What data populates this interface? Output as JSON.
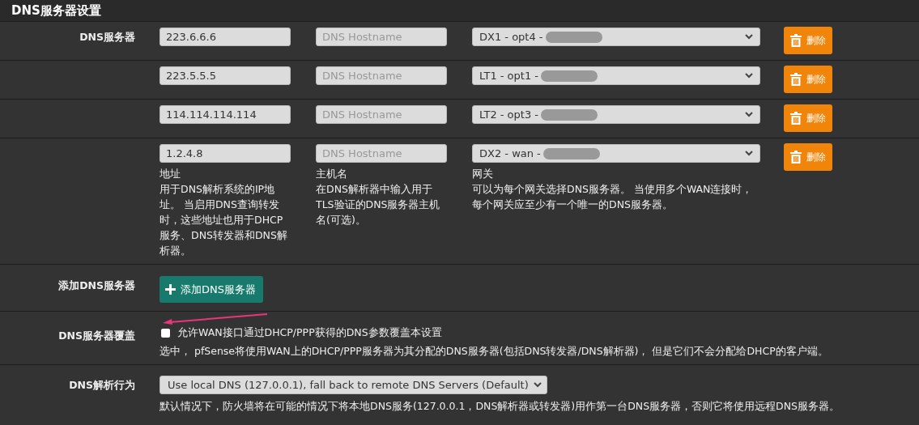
{
  "section_title": "DNS服务器设置",
  "dns_servers": {
    "label": "DNS服务器",
    "rows": [
      {
        "address": "223.6.6.6",
        "placeholder": "DNS Hostname",
        "gateway": "DX1 - opt4 -",
        "delete_label": "删除"
      },
      {
        "address": "223.5.5.5",
        "placeholder": "DNS Hostname",
        "gateway": "LT1 - opt1 -",
        "delete_label": "删除"
      },
      {
        "address": "114.114.114.114",
        "placeholder": "DNS Hostname",
        "gateway": "LT2 - opt3 -",
        "delete_label": "删除"
      },
      {
        "address": "1.2.4.8",
        "placeholder": "DNS Hostname",
        "gateway": "DX2 - wan -",
        "delete_label": "删除"
      }
    ],
    "help": [
      {
        "title": "地址",
        "text": "用于DNS解析系统的IP地址。 当启用DNS查询转发时，这些地址也用于DHCP服务、DNS转发器和DNS解析器。"
      },
      {
        "title": "主机名",
        "text": "在DNS解析器中输入用于TLS验证的DNS服务器主机名(可选)。"
      },
      {
        "title": "网关",
        "text": "可以为每个网关选择DNS服务器。 当使用多个WAN连接时，每个网关应至少有一个唯一的DNS服务器。"
      }
    ]
  },
  "add_server": {
    "label": "添加DNS服务器",
    "button": "添加DNS服务器"
  },
  "override": {
    "label": "DNS服务器覆盖",
    "checked": false,
    "checkbox_label": "允许WAN接口通过DHCP/PPP获得的DNS参数覆盖本设置",
    "help": "选中， pfSense将使用WAN上的DHCP/PPP服务器为其分配的DNS服务器(包括DNS转发器/DNS解析器)， 但是它们不会分配给DHCP的客户端。"
  },
  "resolution": {
    "label": "DNS解析行为",
    "value": "Use local DNS (127.0.0.1), fall back to remote DNS Servers (Default)",
    "help": "默认情况下，防火墙将在可能的情况下将本地DNS服务(127.0.0.1，DNS解析器或转发器)用作第一台DNS服务器，否则它将使用远程DNS服务器。"
  }
}
